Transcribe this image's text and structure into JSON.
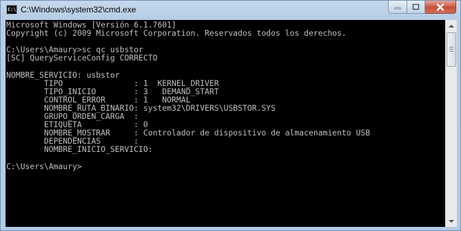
{
  "window": {
    "title": "C:\\Windows\\system32\\cmd.exe",
    "icon_label": "C:\\"
  },
  "controls": {
    "minimize": "minimize",
    "maximize": "maximize",
    "close": "close"
  },
  "console": {
    "lines": [
      "Microsoft Windows [Versión 6.1.7601]",
      "Copyright (c) 2009 Microsoft Corporation. Reservados todos los derechos.",
      "",
      "C:\\Users\\Amaury>sc qc usbstor",
      "[SC] QueryServiceConfig CORRECTO",
      "",
      "NOMBRE_SERVICIO: usbstor",
      "        TIPO               : 1  KERNEL_DRIVER",
      "        TIPO_INICIO        : 3   DEMAND_START",
      "        CONTROL_ERROR      : 1   NORMAL",
      "        NOMBRE_RUTA_BINARIO: system32\\DRIVERS\\USBSTOR.SYS",
      "        GRUPO_ORDEN_CARGA  :",
      "        ETIQUETA           : 0",
      "        NOMBRE_MOSTRAR     : Controlador de dispositivo de almacenamiento USB",
      "        DEPENDENCIAS       :",
      "        NOMBRE_INICIO_SERVICIO:",
      "",
      "C:\\Users\\Amaury>"
    ]
  },
  "colors": {
    "console_bg": "#000000",
    "console_fg": "#c0c0c0",
    "title_bar": "#b9d1ea",
    "close_button": "#c74f38"
  }
}
